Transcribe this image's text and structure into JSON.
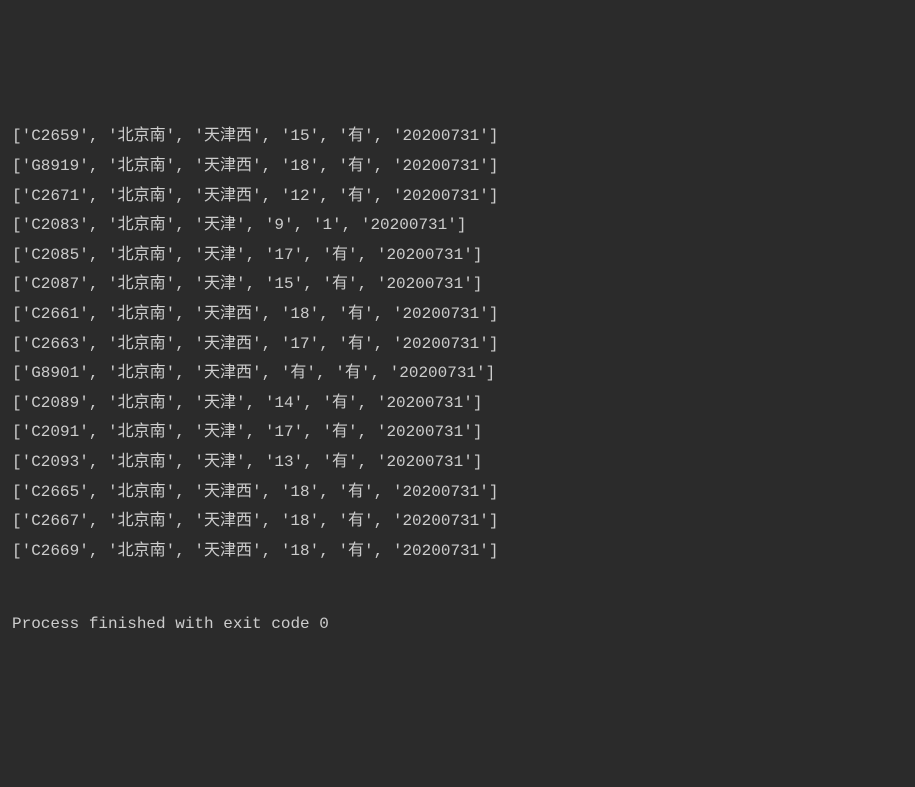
{
  "rows": [
    {
      "train": "C2659",
      "from": "北京南",
      "to": "天津西",
      "col4": "15",
      "col5": "有",
      "date": "20200731"
    },
    {
      "train": "G8919",
      "from": "北京南",
      "to": "天津西",
      "col4": "18",
      "col5": "有",
      "date": "20200731"
    },
    {
      "train": "C2671",
      "from": "北京南",
      "to": "天津西",
      "col4": "12",
      "col5": "有",
      "date": "20200731"
    },
    {
      "train": "C2083",
      "from": "北京南",
      "to": "天津",
      "col4": "9",
      "col5": "1",
      "date": "20200731"
    },
    {
      "train": "C2085",
      "from": "北京南",
      "to": "天津",
      "col4": "17",
      "col5": "有",
      "date": "20200731"
    },
    {
      "train": "C2087",
      "from": "北京南",
      "to": "天津",
      "col4": "15",
      "col5": "有",
      "date": "20200731"
    },
    {
      "train": "C2661",
      "from": "北京南",
      "to": "天津西",
      "col4": "18",
      "col5": "有",
      "date": "20200731"
    },
    {
      "train": "C2663",
      "from": "北京南",
      "to": "天津西",
      "col4": "17",
      "col5": "有",
      "date": "20200731"
    },
    {
      "train": "G8901",
      "from": "北京南",
      "to": "天津西",
      "col4": "有",
      "col5": "有",
      "date": "20200731"
    },
    {
      "train": "C2089",
      "from": "北京南",
      "to": "天津",
      "col4": "14",
      "col5": "有",
      "date": "20200731"
    },
    {
      "train": "C2091",
      "from": "北京南",
      "to": "天津",
      "col4": "17",
      "col5": "有",
      "date": "20200731"
    },
    {
      "train": "C2093",
      "from": "北京南",
      "to": "天津",
      "col4": "13",
      "col5": "有",
      "date": "20200731"
    },
    {
      "train": "C2665",
      "from": "北京南",
      "to": "天津西",
      "col4": "18",
      "col5": "有",
      "date": "20200731"
    },
    {
      "train": "C2667",
      "from": "北京南",
      "to": "天津西",
      "col4": "18",
      "col5": "有",
      "date": "20200731"
    },
    {
      "train": "C2669",
      "from": "北京南",
      "to": "天津西",
      "col4": "18",
      "col5": "有",
      "date": "20200731"
    }
  ],
  "footer": "Process finished with exit code 0"
}
